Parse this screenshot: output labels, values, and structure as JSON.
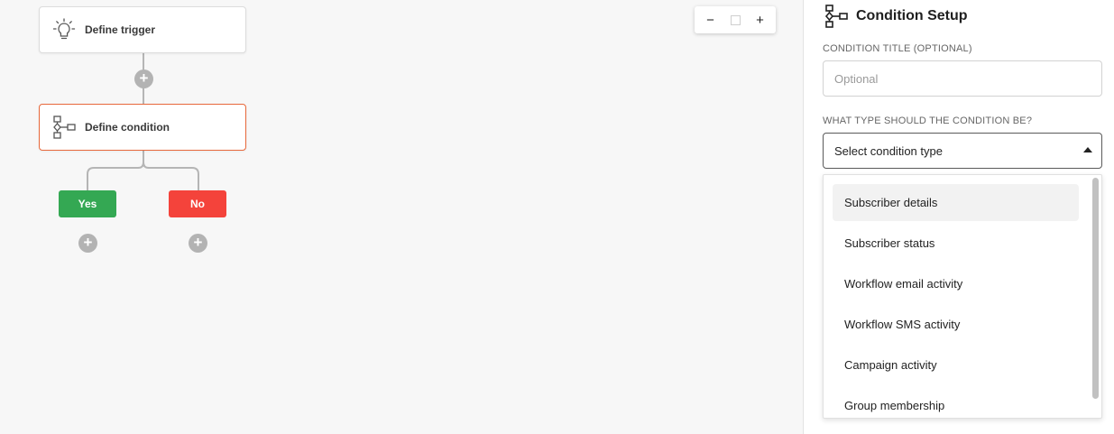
{
  "canvas": {
    "trigger_node": {
      "label": "Define trigger",
      "icon": "lightbulb-icon"
    },
    "condition_node": {
      "label": "Define condition",
      "icon": "flowchart-icon"
    },
    "branches": {
      "yes_label": "Yes",
      "no_label": "No"
    },
    "plus_symbol": "+",
    "zoom": {
      "zoom_out": "−",
      "zoom_in": "+"
    }
  },
  "panel": {
    "title": "Condition Setup",
    "icon": "flowchart-icon",
    "title_field": {
      "label": "CONDITION TITLE (OPTIONAL)",
      "placeholder": "Optional",
      "value": ""
    },
    "type_field": {
      "label": "WHAT TYPE SHOULD THE CONDITION BE?",
      "selected": "Select condition type"
    },
    "options": [
      "Subscriber details",
      "Subscriber status",
      "Workflow email activity",
      "Workflow SMS activity",
      "Campaign activity",
      "Group membership"
    ]
  },
  "colors": {
    "accent_orange": "#e8693c",
    "yes_green": "#34a853",
    "no_red": "#f4433b",
    "plus_gray": "#b3b3b3"
  }
}
